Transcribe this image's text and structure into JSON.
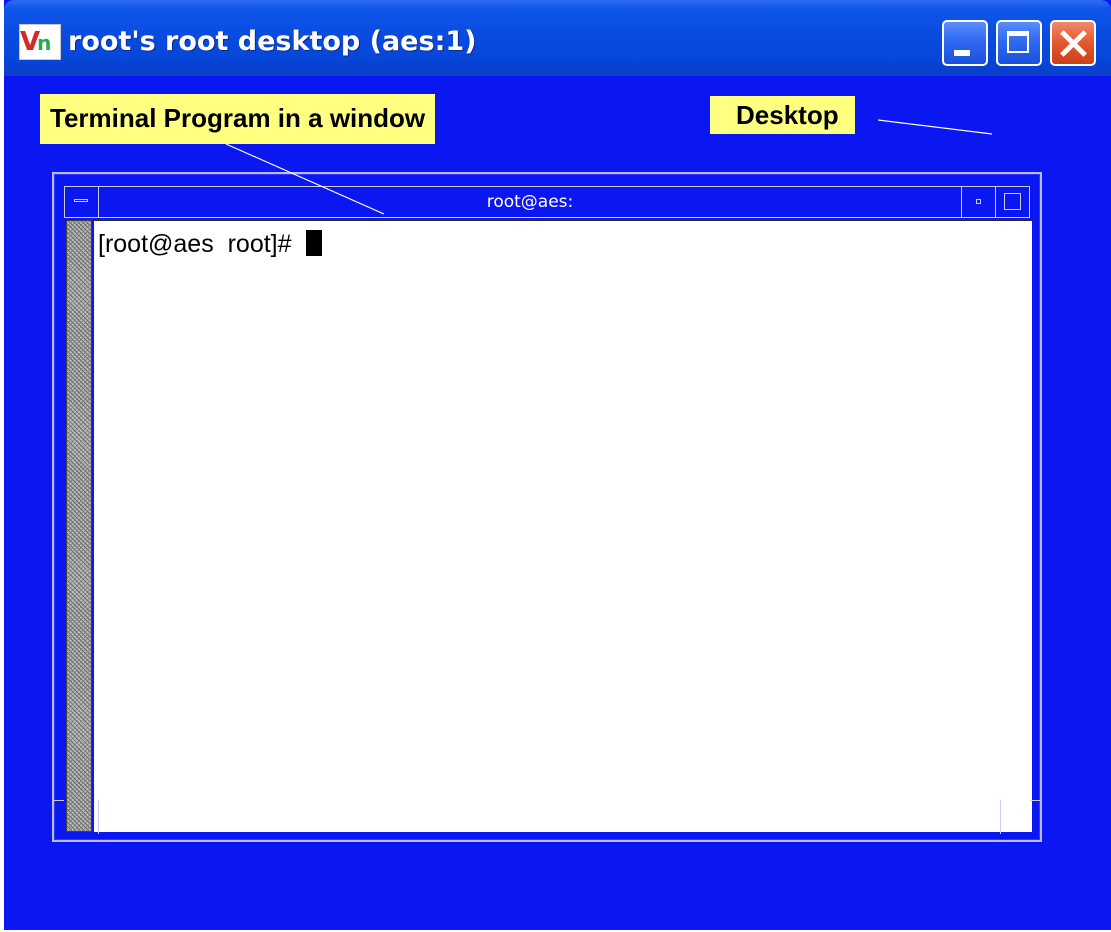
{
  "outer_window": {
    "title": "root's root desktop (aes:1)",
    "logo_text_v": "V",
    "logo_text_n": "n",
    "buttons": {
      "minimize": "minimize",
      "maximize": "maximize",
      "close": "close"
    }
  },
  "annotations": {
    "terminal": "Terminal Program in a window",
    "desktop": "Desktop"
  },
  "terminal_window": {
    "title": "root@aes:",
    "prompt": "[root@aes  root]#"
  },
  "colors": {
    "desktop_background": "#0a17f0",
    "titlebar": "#0a4ce0",
    "callout": "#ffff80",
    "terminal_background": "#ffffff"
  },
  "icons": {
    "app_logo": "vnc-logo-icon",
    "window_menu": "window-menu-icon",
    "iconify": "iconify-icon",
    "maximize": "maximize-icon"
  }
}
